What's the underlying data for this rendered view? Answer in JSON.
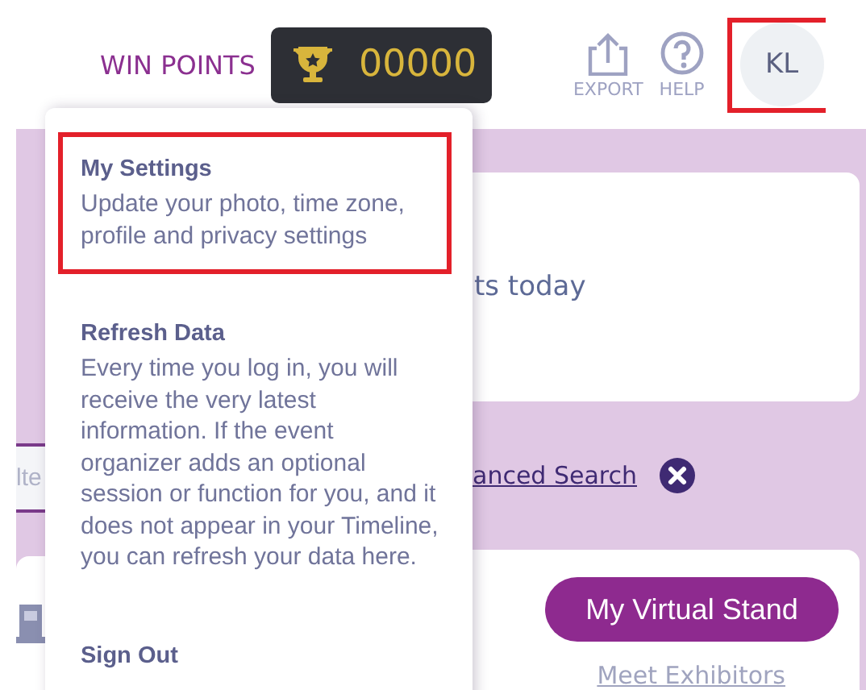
{
  "header": {
    "points_label": "WIN POINTS",
    "points": "00000",
    "actions": [
      {
        "label": "EXPORT",
        "kind": "export"
      },
      {
        "label": "HELP",
        "kind": "help"
      }
    ],
    "avatar": {
      "initials": "KL",
      "highlighted": true
    }
  },
  "menu": {
    "items": [
      {
        "title": "My Settings",
        "description": "Update your photo, time zone, profile and privacy settings",
        "highlighted": true
      },
      {
        "title": "Refresh Data",
        "description": "Every time you log in, you will receive the very latest information. If the event organizer adds an optional session or function for you, and it does not appear in your Timeline, you can refresh your data here.",
        "highlighted": false
      },
      {
        "title": "Sign Out",
        "highlighted": false
      }
    ]
  },
  "background": {
    "summary_text": "ts today",
    "search": {
      "placeholder": "lte",
      "link": "anced Search"
    },
    "stand_button": "My Virtual Stand",
    "exhibitors_link": "Meet Exhibitors"
  }
}
